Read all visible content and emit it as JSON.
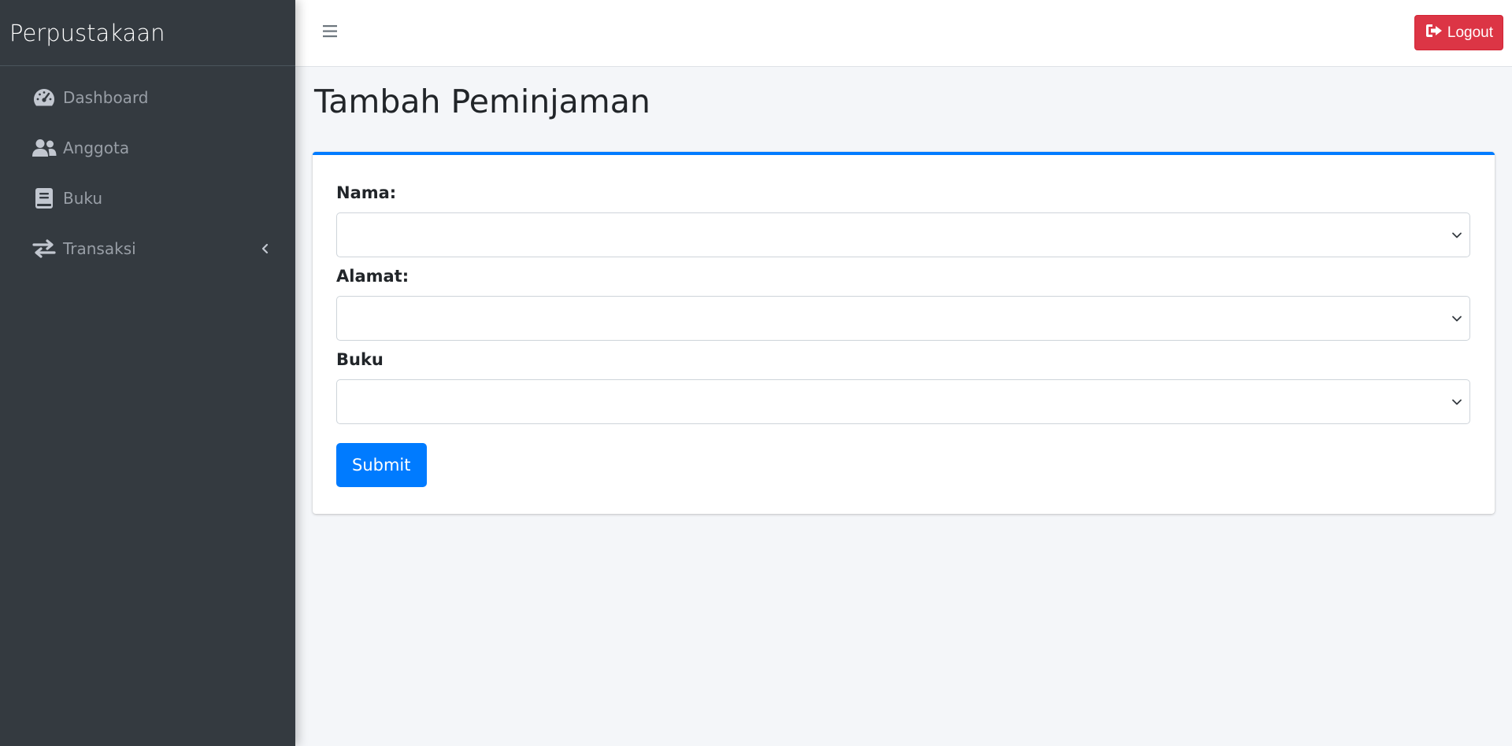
{
  "sidebar": {
    "brand": "Perpustakaan",
    "items": [
      {
        "label": "Dashboard",
        "icon": "tachometer-icon"
      },
      {
        "label": "Anggota",
        "icon": "users-icon"
      },
      {
        "label": "Buku",
        "icon": "book-icon"
      },
      {
        "label": "Transaksi",
        "icon": "exchange-icon",
        "expandable": true
      }
    ]
  },
  "topbar": {
    "menu_icon": "hamburger-icon",
    "logout_label": "Logout",
    "logout_icon": "sign-out-icon"
  },
  "main": {
    "title": "Tambah Peminjaman",
    "form": {
      "fields": [
        {
          "label": "Nama:",
          "value": ""
        },
        {
          "label": "Alamat:",
          "value": ""
        },
        {
          "label": "Buku",
          "value": ""
        }
      ],
      "submit_label": "Submit"
    }
  },
  "colors": {
    "sidebar_bg": "#343a40",
    "accent": "#007bff",
    "danger": "#dc3545",
    "content_bg": "#f4f6f9"
  }
}
